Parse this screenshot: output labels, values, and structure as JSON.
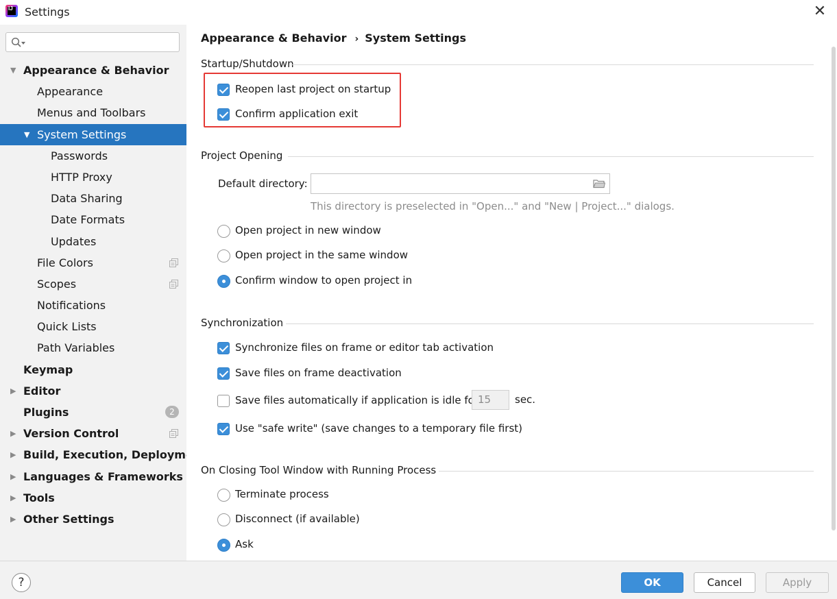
{
  "window": {
    "title": "Settings"
  },
  "sidebar": {
    "search": {
      "placeholder": ""
    },
    "items": [
      {
        "label": "Appearance & Behavior",
        "level": 0,
        "expanded": true
      },
      {
        "label": "Appearance",
        "level": 1
      },
      {
        "label": "Menus and Toolbars",
        "level": 1
      },
      {
        "label": "System Settings",
        "level": 1,
        "expanded": true,
        "selected": true
      },
      {
        "label": "Passwords",
        "level": 2
      },
      {
        "label": "HTTP Proxy",
        "level": 2
      },
      {
        "label": "Data Sharing",
        "level": 2
      },
      {
        "label": "Date Formats",
        "level": 2
      },
      {
        "label": "Updates",
        "level": 2
      },
      {
        "label": "File Colors",
        "level": 1,
        "icon": "copy-icon"
      },
      {
        "label": "Scopes",
        "level": 1,
        "icon": "copy-icon"
      },
      {
        "label": "Notifications",
        "level": 1
      },
      {
        "label": "Quick Lists",
        "level": 1
      },
      {
        "label": "Path Variables",
        "level": 1
      },
      {
        "label": "Keymap",
        "level": 0
      },
      {
        "label": "Editor",
        "level": 0,
        "collapsed": true
      },
      {
        "label": "Plugins",
        "level": 0,
        "badge": "2"
      },
      {
        "label": "Version Control",
        "level": 0,
        "collapsed": true,
        "icon": "copy-icon"
      },
      {
        "label": "Build, Execution, Deployment",
        "level": 0,
        "collapsed": true
      },
      {
        "label": "Languages & Frameworks",
        "level": 0,
        "collapsed": true
      },
      {
        "label": "Tools",
        "level": 0,
        "collapsed": true
      },
      {
        "label": "Other Settings",
        "level": 0,
        "collapsed": true
      }
    ]
  },
  "content": {
    "breadcrumb": {
      "parent": "Appearance & Behavior",
      "separator": "›",
      "current": "System Settings"
    },
    "startup": {
      "title": "Startup/Shutdown",
      "reopen_label": "Reopen last project on startup",
      "reopen_checked": true,
      "confirm_exit_label": "Confirm application exit",
      "confirm_exit_checked": true
    },
    "project_opening": {
      "title": "Project Opening",
      "default_dir_label": "Default directory:",
      "default_dir_value": "",
      "hint": "This directory is preselected in \"Open...\" and \"New | Project...\" dialogs.",
      "options": [
        "Open project in new window",
        "Open project in the same window",
        "Confirm window to open project in"
      ],
      "selected": "Confirm window to open project in"
    },
    "sync": {
      "title": "Synchronization",
      "sync_files_label": "Synchronize files on frame or editor tab activation",
      "sync_files_checked": true,
      "save_deactivation_label": "Save files on frame deactivation",
      "save_deactivation_checked": true,
      "save_idle_label": "Save files automatically if application is idle for",
      "save_idle_checked": false,
      "idle_value": "15",
      "idle_unit": "sec.",
      "safe_write_label": "Use \"safe write\" (save changes to a temporary file first)",
      "safe_write_checked": true
    },
    "closing": {
      "title": "On Closing Tool Window with Running Process",
      "options": [
        "Terminate process",
        "Disconnect (if available)",
        "Ask"
      ],
      "selected": "Ask"
    }
  },
  "footer": {
    "help_label": "?",
    "ok_label": "OK",
    "cancel_label": "Cancel",
    "apply_label": "Apply"
  },
  "colors": {
    "accent": "#3c8fd9",
    "selection": "#2675bf",
    "highlight_border": "#e53935",
    "sidebar_bg": "#f2f2f2"
  }
}
